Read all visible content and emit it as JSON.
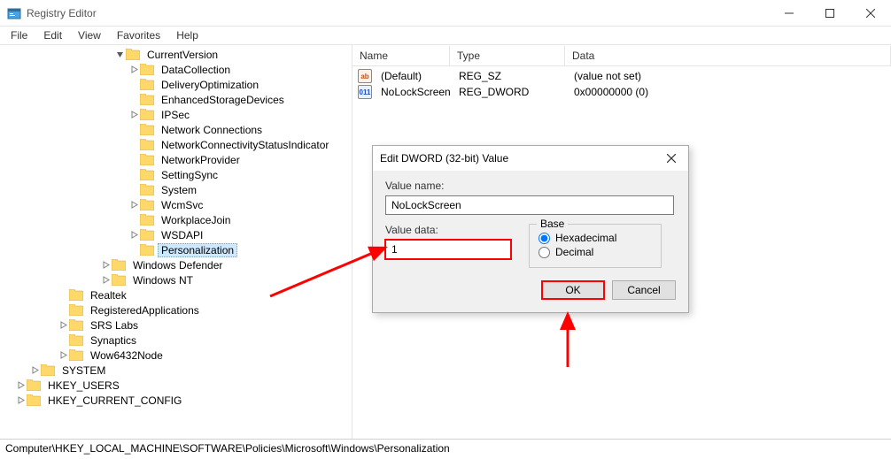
{
  "window": {
    "title": "Registry Editor"
  },
  "menu": {
    "file": "File",
    "edit": "Edit",
    "view": "View",
    "favorites": "Favorites",
    "help": "Help"
  },
  "tree": {
    "items": [
      {
        "indent": 8,
        "twisty": "v",
        "label": "CurrentVersion"
      },
      {
        "indent": 9,
        "twisty": ">",
        "label": "DataCollection"
      },
      {
        "indent": 9,
        "twisty": "",
        "label": "DeliveryOptimization"
      },
      {
        "indent": 9,
        "twisty": "",
        "label": "EnhancedStorageDevices"
      },
      {
        "indent": 9,
        "twisty": ">",
        "label": "IPSec"
      },
      {
        "indent": 9,
        "twisty": "",
        "label": "Network Connections"
      },
      {
        "indent": 9,
        "twisty": "",
        "label": "NetworkConnectivityStatusIndicator"
      },
      {
        "indent": 9,
        "twisty": "",
        "label": "NetworkProvider"
      },
      {
        "indent": 9,
        "twisty": "",
        "label": "SettingSync"
      },
      {
        "indent": 9,
        "twisty": "",
        "label": "System"
      },
      {
        "indent": 9,
        "twisty": ">",
        "label": "WcmSvc"
      },
      {
        "indent": 9,
        "twisty": "",
        "label": "WorkplaceJoin"
      },
      {
        "indent": 9,
        "twisty": ">",
        "label": "WSDAPI"
      },
      {
        "indent": 9,
        "twisty": "",
        "label": "Personalization",
        "selected": true
      },
      {
        "indent": 7,
        "twisty": ">",
        "label": "Windows Defender"
      },
      {
        "indent": 7,
        "twisty": ">",
        "label": "Windows NT"
      },
      {
        "indent": 4,
        "twisty": "",
        "label": "Realtek"
      },
      {
        "indent": 4,
        "twisty": "",
        "label": "RegisteredApplications"
      },
      {
        "indent": 4,
        "twisty": ">",
        "label": "SRS Labs"
      },
      {
        "indent": 4,
        "twisty": "",
        "label": "Synaptics"
      },
      {
        "indent": 4,
        "twisty": ">",
        "label": "Wow6432Node"
      },
      {
        "indent": 2,
        "twisty": ">",
        "label": "SYSTEM"
      },
      {
        "indent": 1,
        "twisty": ">",
        "label": "HKEY_USERS"
      },
      {
        "indent": 1,
        "twisty": ">",
        "label": "HKEY_CURRENT_CONFIG"
      }
    ]
  },
  "list": {
    "headers": {
      "name": "Name",
      "type": "Type",
      "data": "Data"
    },
    "rows": [
      {
        "icon": "sz",
        "name": "(Default)",
        "type": "REG_SZ",
        "data": "(value not set)"
      },
      {
        "icon": "dw",
        "name": "NoLockScreen",
        "type": "REG_DWORD",
        "data": "0x00000000 (0)"
      }
    ]
  },
  "dialog": {
    "title": "Edit DWORD (32-bit) Value",
    "value_name_label": "Value name:",
    "value_name": "NoLockScreen",
    "value_data_label": "Value data:",
    "value_data": "1",
    "base_label": "Base",
    "hex_label": "Hexadecimal",
    "dec_label": "Decimal",
    "ok": "OK",
    "cancel": "Cancel"
  },
  "statusbar": "Computer\\HKEY_LOCAL_MACHINE\\SOFTWARE\\Policies\\Microsoft\\Windows\\Personalization"
}
